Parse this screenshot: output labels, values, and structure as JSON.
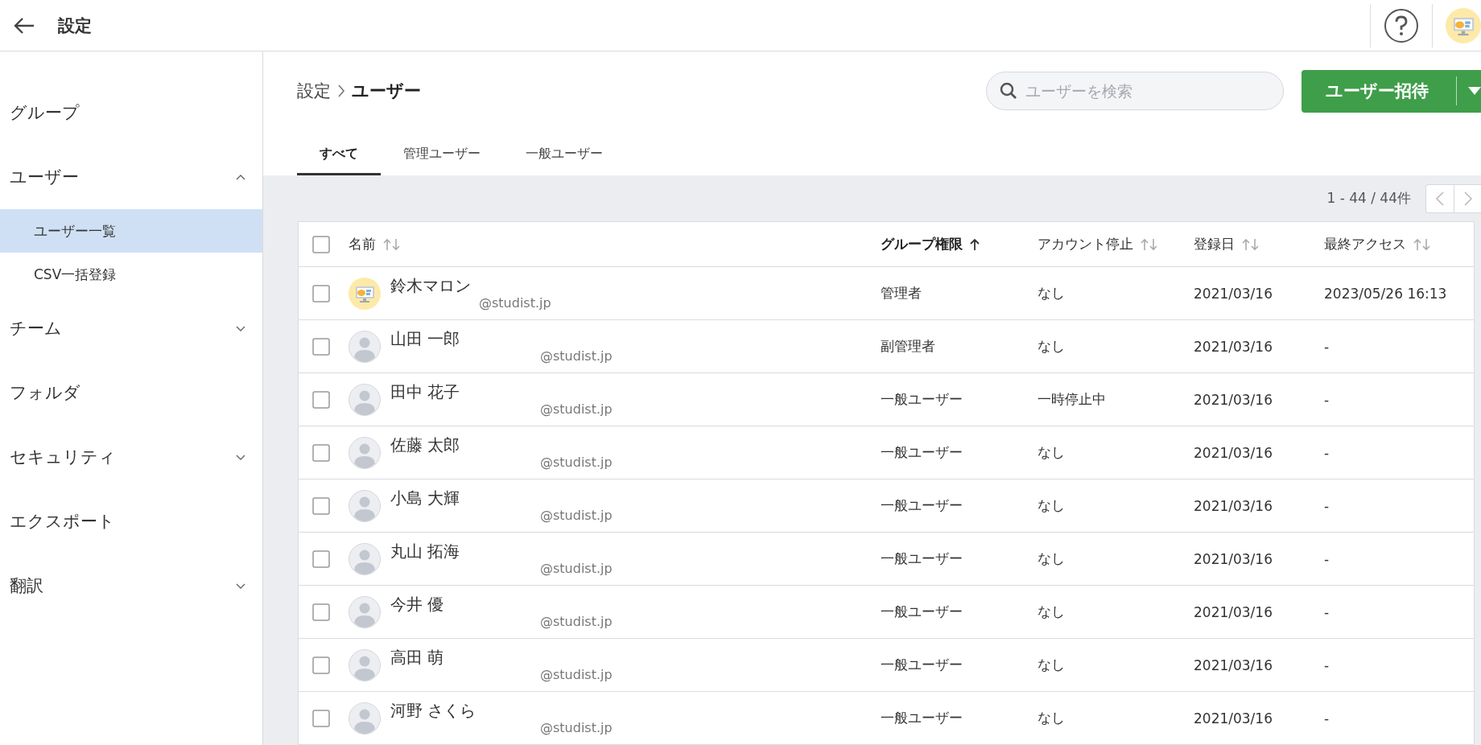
{
  "header": {
    "title": "設定"
  },
  "sidebar": {
    "items": [
      {
        "label": "グループ"
      },
      {
        "label": "ユーザー",
        "expanded": true,
        "children": [
          {
            "label": "ユーザー一覧",
            "selected": true
          },
          {
            "label": "CSV一括登録",
            "selected": false
          }
        ]
      },
      {
        "label": "チーム",
        "expanded": false
      },
      {
        "label": "フォルダ"
      },
      {
        "label": "セキュリティ",
        "expanded": false
      },
      {
        "label": "エクスポート"
      },
      {
        "label": "翻訳",
        "expanded": false
      }
    ]
  },
  "breadcrumb": [
    "設定",
    "ユーザー"
  ],
  "search": {
    "placeholder": "ユーザーを検索"
  },
  "invite_button": {
    "label": "ユーザー招待"
  },
  "tabs": [
    {
      "label": "すべて",
      "selected": true
    },
    {
      "label": "管理ユーザー",
      "selected": false
    },
    {
      "label": "一般ユーザー",
      "selected": false
    }
  ],
  "pagination": {
    "range": "1 - 44 / 44件"
  },
  "table": {
    "select_all": {
      "checked": false
    },
    "columns": [
      {
        "label": "名前",
        "sorted": false
      },
      {
        "label": "グループ権限",
        "sorted": true
      },
      {
        "label": "アカウント停止",
        "sorted": false
      },
      {
        "label": "登録日",
        "sorted": false
      },
      {
        "label": "最終アクセス",
        "sorted": false
      }
    ],
    "rows": [
      {
        "checked": false,
        "kind": "mascot",
        "name": "鈴木マロン",
        "email": "@studist.jp",
        "role": "管理者",
        "suspended": "なし",
        "registered": "2021/03/16",
        "last_access": "2023/05/26 16:13"
      },
      {
        "checked": false,
        "kind": "default",
        "name": "山田 一郎",
        "email": "@studist.jp",
        "role": "副管理者",
        "suspended": "なし",
        "registered": "2021/03/16",
        "last_access": "-"
      },
      {
        "checked": false,
        "kind": "default",
        "name": "田中 花子",
        "email": "@studist.jp",
        "role": "一般ユーザー",
        "suspended": "一時停止中",
        "registered": "2021/03/16",
        "last_access": "-"
      },
      {
        "checked": false,
        "kind": "default",
        "name": "佐藤 太郎",
        "email": "@studist.jp",
        "role": "一般ユーザー",
        "suspended": "なし",
        "registered": "2021/03/16",
        "last_access": "-"
      },
      {
        "checked": false,
        "kind": "default",
        "name": "小島 大輝",
        "email": "@studist.jp",
        "role": "一般ユーザー",
        "suspended": "なし",
        "registered": "2021/03/16",
        "last_access": "-"
      },
      {
        "checked": false,
        "kind": "default",
        "name": "丸山 拓海",
        "email": "@studist.jp",
        "role": "一般ユーザー",
        "suspended": "なし",
        "registered": "2021/03/16",
        "last_access": "-"
      },
      {
        "checked": false,
        "kind": "default",
        "name": "今井 優",
        "email": "@studist.jp",
        "role": "一般ユーザー",
        "suspended": "なし",
        "registered": "2021/03/16",
        "last_access": "-"
      },
      {
        "checked": false,
        "kind": "default",
        "name": "高田 萌",
        "email": "@studist.jp",
        "role": "一般ユーザー",
        "suspended": "なし",
        "registered": "2021/03/16",
        "last_access": "-"
      },
      {
        "checked": false,
        "kind": "default",
        "name": "河野 さくら",
        "email": "@studist.jp",
        "role": "一般ユーザー",
        "suspended": "なし",
        "registered": "2021/03/16",
        "last_access": "-"
      }
    ]
  }
}
